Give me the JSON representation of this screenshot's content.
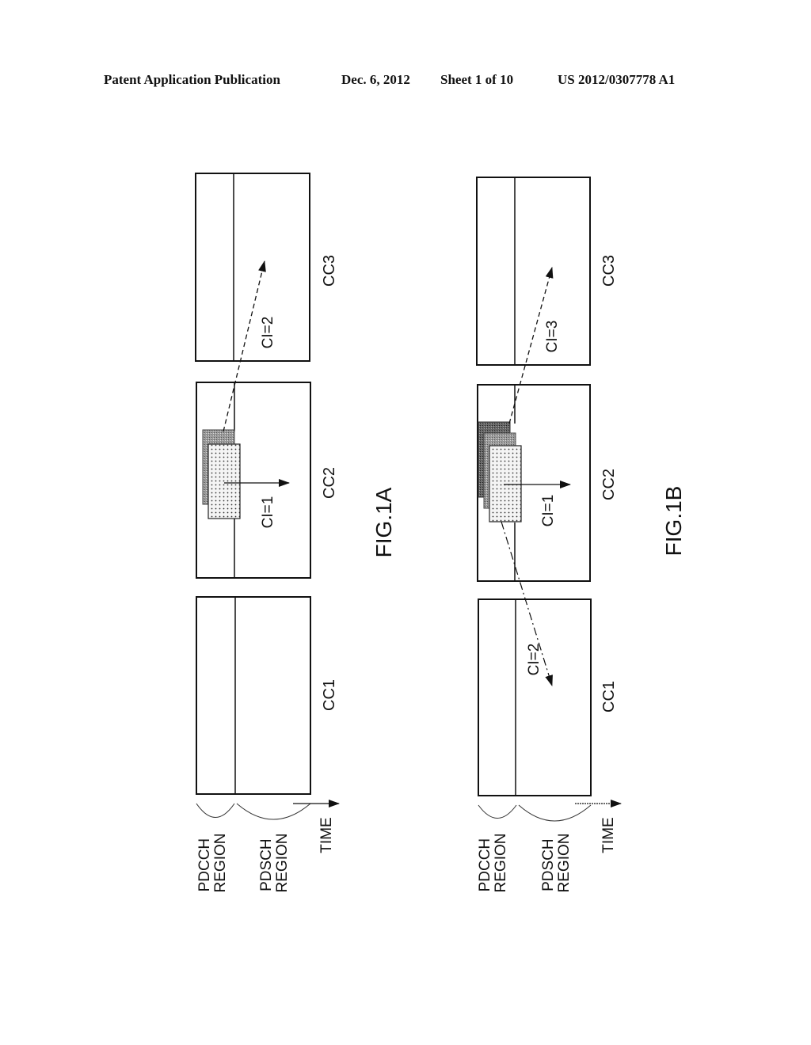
{
  "header": {
    "publication": "Patent Application Publication",
    "date": "Dec. 6, 2012",
    "sheet": "Sheet 1 of 10",
    "number": "US 2012/0307778 A1"
  },
  "figures": [
    {
      "id": "fig1a",
      "caption": "FIG.1A",
      "carriers": [
        "CC1",
        "CC2",
        "CC3"
      ],
      "regions": [
        "PDCCH REGION",
        "PDSCH REGION"
      ],
      "time_label": "TIME",
      "arrows": [
        {
          "label": "CI=1",
          "from": "CC2",
          "to": "CC2",
          "style": "solid"
        },
        {
          "label": "CI=2",
          "from": "CC2",
          "to": "CC3",
          "style": "dashed"
        }
      ]
    },
    {
      "id": "fig1b",
      "caption": "FIG.1B",
      "carriers": [
        "CC1",
        "CC2",
        "CC3"
      ],
      "regions": [
        "PDCCH REGION",
        "PDSCH REGION"
      ],
      "time_label": "TIME",
      "arrows": [
        {
          "label": "CI=1",
          "from": "CC2",
          "to": "CC2",
          "style": "solid"
        },
        {
          "label": "CI=3",
          "from": "CC2",
          "to": "CC3",
          "style": "dashed"
        },
        {
          "label": "CI=2",
          "from": "CC2",
          "to": "CC1",
          "style": "dash-dot"
        }
      ]
    }
  ]
}
